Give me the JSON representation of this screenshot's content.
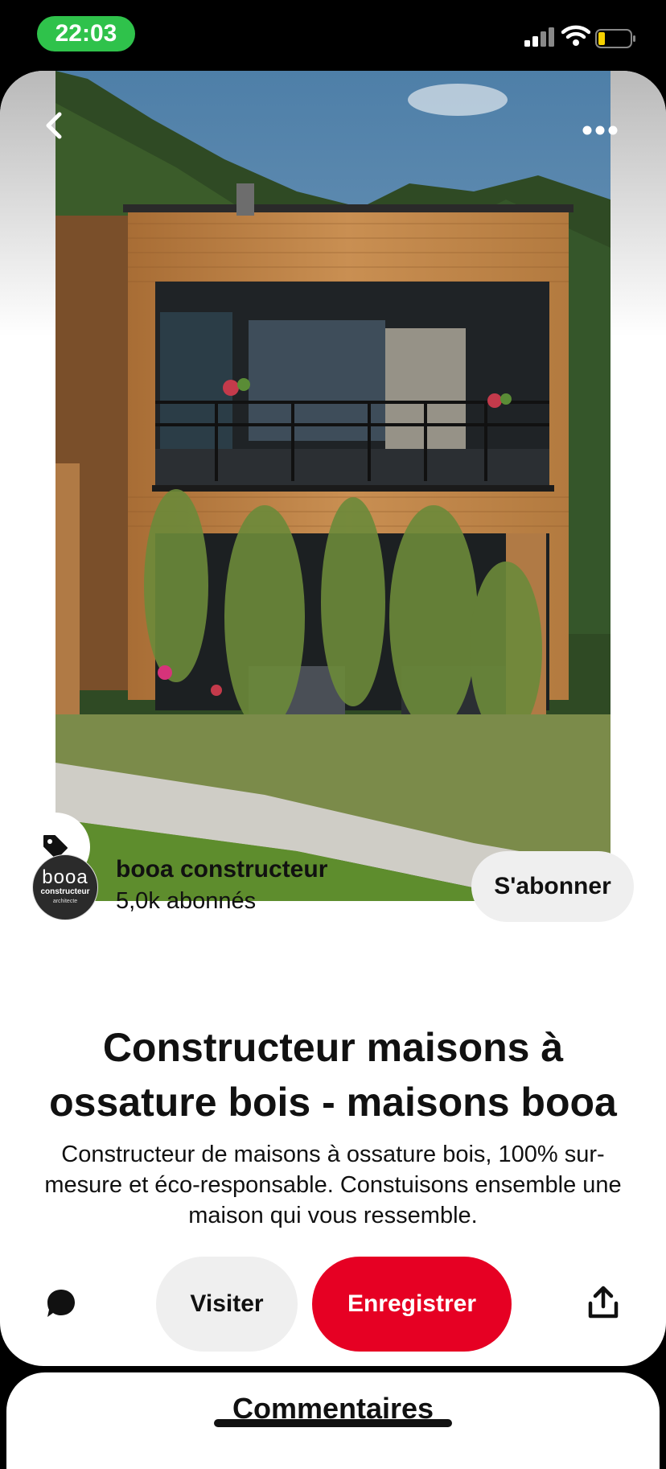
{
  "status_bar": {
    "time": "22:03"
  },
  "pin": {
    "creator": {
      "avatar_text": "booa",
      "avatar_sub": "constructeur",
      "avatar_tiny": "architecte",
      "name": "booa constructeur",
      "followers": "5,0k abonnés",
      "follow_label": "S'abonner"
    },
    "title": "Constructeur maisons à ossature bois - maisons booa",
    "description": "Constructeur de maisons à ossature bois, 100% sur-mesure et éco-responsable. Constuisons ensemble une maison qui vous ressemble."
  },
  "actions": {
    "visit_label": "Visiter",
    "save_label": "Enregistrer"
  },
  "comments": {
    "title": "Commentaires"
  },
  "colors": {
    "save": "#e60023",
    "time_pill": "#2fc24b"
  },
  "icons": [
    "signal-icon",
    "wifi-icon",
    "battery-icon",
    "back-arrow-icon",
    "more-icon",
    "tag-icon",
    "comment-icon",
    "share-icon"
  ]
}
